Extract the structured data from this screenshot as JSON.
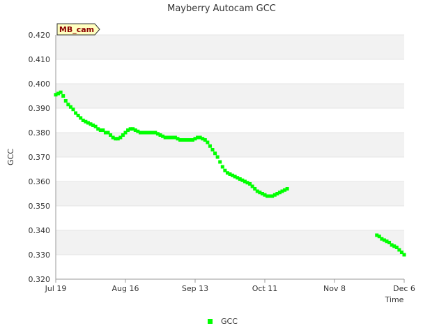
{
  "chart_data": {
    "type": "scatter",
    "title": "Mayberry Autocam GCC",
    "xlabel": "Time",
    "ylabel": "GCC",
    "tag": "MB_cam",
    "ylim": [
      0.32,
      0.42
    ],
    "yticks": [
      "0.320",
      "0.330",
      "0.340",
      "0.350",
      "0.360",
      "0.370",
      "0.380",
      "0.390",
      "0.400",
      "0.410",
      "0.420"
    ],
    "xlim": [
      "2021-07-19",
      "2021-12-06"
    ],
    "xticks": [
      {
        "date": "2021-07-19",
        "label": "Jul 19"
      },
      {
        "date": "2021-08-16",
        "label": "Aug 16"
      },
      {
        "date": "2021-09-13",
        "label": "Sep 13"
      },
      {
        "date": "2021-10-11",
        "label": "Oct 11"
      },
      {
        "date": "2021-11-08",
        "label": "Nov 8"
      },
      {
        "date": "2021-12-06",
        "label": "Dec 6"
      }
    ],
    "grid": "alternating horizontal bands",
    "legend": "bottom-center",
    "series": [
      {
        "name": "GCC",
        "color": "#00ff00",
        "marker": "square",
        "points": [
          [
            "2021-07-19",
            0.3955
          ],
          [
            "2021-07-20",
            0.396
          ],
          [
            "2021-07-21",
            0.3965
          ],
          [
            "2021-07-22",
            0.395
          ],
          [
            "2021-07-23",
            0.393
          ],
          [
            "2021-07-24",
            0.3915
          ],
          [
            "2021-07-25",
            0.3905
          ],
          [
            "2021-07-26",
            0.3895
          ],
          [
            "2021-07-27",
            0.388
          ],
          [
            "2021-07-28",
            0.387
          ],
          [
            "2021-07-29",
            0.386
          ],
          [
            "2021-07-30",
            0.385
          ],
          [
            "2021-07-31",
            0.3845
          ],
          [
            "2021-08-01",
            0.384
          ],
          [
            "2021-08-02",
            0.3835
          ],
          [
            "2021-08-03",
            0.383
          ],
          [
            "2021-08-04",
            0.3825
          ],
          [
            "2021-08-05",
            0.3815
          ],
          [
            "2021-08-06",
            0.381
          ],
          [
            "2021-08-07",
            0.381
          ],
          [
            "2021-08-08",
            0.38
          ],
          [
            "2021-08-09",
            0.38
          ],
          [
            "2021-08-10",
            0.379
          ],
          [
            "2021-08-11",
            0.378
          ],
          [
            "2021-08-12",
            0.3775
          ],
          [
            "2021-08-13",
            0.3775
          ],
          [
            "2021-08-14",
            0.378
          ],
          [
            "2021-08-15",
            0.379
          ],
          [
            "2021-08-16",
            0.38
          ],
          [
            "2021-08-17",
            0.381
          ],
          [
            "2021-08-18",
            0.3815
          ],
          [
            "2021-08-19",
            0.3815
          ],
          [
            "2021-08-20",
            0.381
          ],
          [
            "2021-08-21",
            0.3805
          ],
          [
            "2021-08-22",
            0.38
          ],
          [
            "2021-08-23",
            0.38
          ],
          [
            "2021-08-24",
            0.38
          ],
          [
            "2021-08-25",
            0.38
          ],
          [
            "2021-08-26",
            0.38
          ],
          [
            "2021-08-27",
            0.38
          ],
          [
            "2021-08-28",
            0.38
          ],
          [
            "2021-08-29",
            0.3795
          ],
          [
            "2021-08-30",
            0.379
          ],
          [
            "2021-08-31",
            0.3785
          ],
          [
            "2021-09-01",
            0.378
          ],
          [
            "2021-09-02",
            0.378
          ],
          [
            "2021-09-03",
            0.378
          ],
          [
            "2021-09-04",
            0.378
          ],
          [
            "2021-09-05",
            0.378
          ],
          [
            "2021-09-06",
            0.3775
          ],
          [
            "2021-09-07",
            0.377
          ],
          [
            "2021-09-08",
            0.377
          ],
          [
            "2021-09-09",
            0.377
          ],
          [
            "2021-09-10",
            0.377
          ],
          [
            "2021-09-11",
            0.377
          ],
          [
            "2021-09-12",
            0.377
          ],
          [
            "2021-09-13",
            0.3775
          ],
          [
            "2021-09-14",
            0.378
          ],
          [
            "2021-09-15",
            0.378
          ],
          [
            "2021-09-16",
            0.3775
          ],
          [
            "2021-09-17",
            0.377
          ],
          [
            "2021-09-18",
            0.376
          ],
          [
            "2021-09-19",
            0.3745
          ],
          [
            "2021-09-20",
            0.373
          ],
          [
            "2021-09-21",
            0.3715
          ],
          [
            "2021-09-22",
            0.37
          ],
          [
            "2021-09-23",
            0.368
          ],
          [
            "2021-09-24",
            0.366
          ],
          [
            "2021-09-25",
            0.3645
          ],
          [
            "2021-09-26",
            0.3635
          ],
          [
            "2021-09-27",
            0.363
          ],
          [
            "2021-09-28",
            0.3625
          ],
          [
            "2021-09-29",
            0.362
          ],
          [
            "2021-09-30",
            0.3615
          ],
          [
            "2021-10-01",
            0.361
          ],
          [
            "2021-10-02",
            0.3605
          ],
          [
            "2021-10-03",
            0.36
          ],
          [
            "2021-10-04",
            0.3595
          ],
          [
            "2021-10-05",
            0.359
          ],
          [
            "2021-10-06",
            0.358
          ],
          [
            "2021-10-07",
            0.357
          ],
          [
            "2021-10-08",
            0.356
          ],
          [
            "2021-10-09",
            0.3555
          ],
          [
            "2021-10-10",
            0.355
          ],
          [
            "2021-10-11",
            0.3545
          ],
          [
            "2021-10-12",
            0.354
          ],
          [
            "2021-10-13",
            0.354
          ],
          [
            "2021-10-14",
            0.354
          ],
          [
            "2021-10-15",
            0.3545
          ],
          [
            "2021-10-16",
            0.355
          ],
          [
            "2021-10-17",
            0.3555
          ],
          [
            "2021-10-18",
            0.356
          ],
          [
            "2021-10-19",
            0.3565
          ],
          [
            "2021-10-20",
            0.357
          ],
          [
            "2021-11-25",
            0.338
          ],
          [
            "2021-11-26",
            0.3375
          ],
          [
            "2021-11-27",
            0.3365
          ],
          [
            "2021-11-28",
            0.336
          ],
          [
            "2021-11-29",
            0.3355
          ],
          [
            "2021-11-30",
            0.335
          ],
          [
            "2021-12-01",
            0.334
          ],
          [
            "2021-12-02",
            0.3335
          ],
          [
            "2021-12-03",
            0.333
          ],
          [
            "2021-12-04",
            0.332
          ],
          [
            "2021-12-05",
            0.331
          ],
          [
            "2021-12-06",
            0.33
          ]
        ]
      }
    ]
  }
}
